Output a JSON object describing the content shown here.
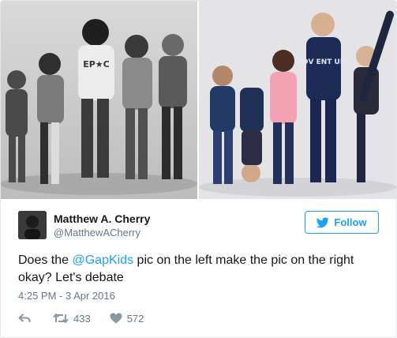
{
  "tweet": {
    "author": {
      "display_name": "Matthew A. Cherry",
      "handle": "@MatthewACherry"
    },
    "follow_label": "Follow",
    "text_parts": {
      "before": "Does the ",
      "mention": "@GapKids",
      "after": " pic on the left make the pic on the right okay? Let's debate"
    },
    "timestamp": "4:25 PM - 3 Apr 2016",
    "retweet_count": "433",
    "like_count": "572",
    "photo_left_print": "EP★C",
    "photo_right_print": "ADV ENT URE"
  },
  "colors": {
    "accent": "#1da1f2",
    "text": "#14171a",
    "muted": "#657786",
    "icon": "#8899a6",
    "border": "#e1e8ed"
  },
  "icons": [
    "bird-icon",
    "reply-icon",
    "retweet-icon",
    "heart-icon"
  ]
}
